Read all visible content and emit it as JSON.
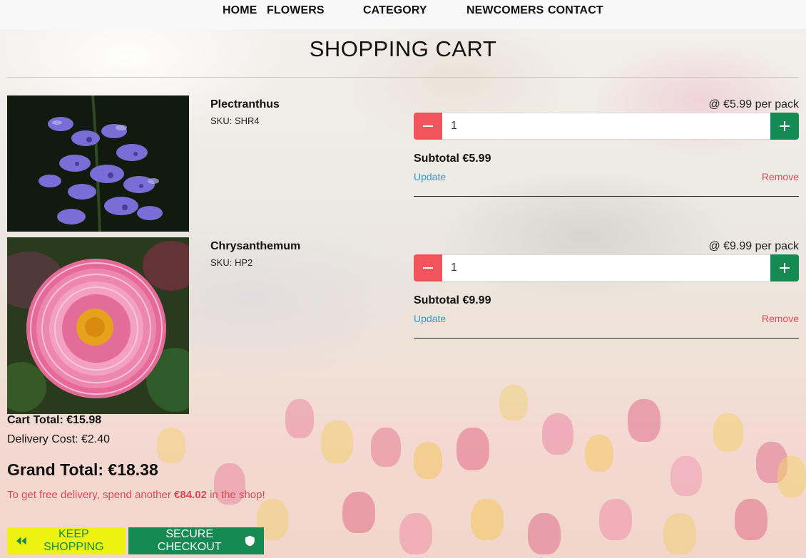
{
  "nav": {
    "home": "HOME",
    "flowers": "FLOWERS",
    "category": "CATEGORY",
    "newcomers": "NEWCOMERS",
    "contact": "CONTACT"
  },
  "page": {
    "title": "SHOPPING CART"
  },
  "items": [
    {
      "name": "Plectranthus",
      "sku": "SKU: SHR4",
      "price": "@ €5.99 per pack",
      "quantity": "1",
      "subtotal": "Subtotal €5.99",
      "update": "Update",
      "remove": "Remove",
      "minus_icon": "minus-icon",
      "plus_icon": "plus-icon"
    },
    {
      "name": "Chrysanthemum",
      "sku": "SKU: HP2",
      "price": "@ €9.99 per pack",
      "quantity": "1",
      "subtotal": "Subtotal €9.99",
      "update": "Update",
      "remove": "Remove",
      "minus_icon": "minus-icon",
      "plus_icon": "plus-icon"
    }
  ],
  "totals": {
    "cart_total": "Cart Total: €15.98",
    "delivery": "Delivery Cost: €2.40",
    "grand_total": "Grand Total: €18.38",
    "free_prefix": "To get free delivery, spend another ",
    "free_amount": "€84.02",
    "free_suffix": " in the shop!"
  },
  "buttons": {
    "keep_shopping": "KEEP SHOPPING",
    "secure_checkout": "SECURE CHECKOUT"
  },
  "colors": {
    "danger": "#f2545b",
    "success": "#158a52",
    "keep_bg": "#eef20e",
    "link": "#2a9fc7",
    "remove": "#e34a5a"
  }
}
